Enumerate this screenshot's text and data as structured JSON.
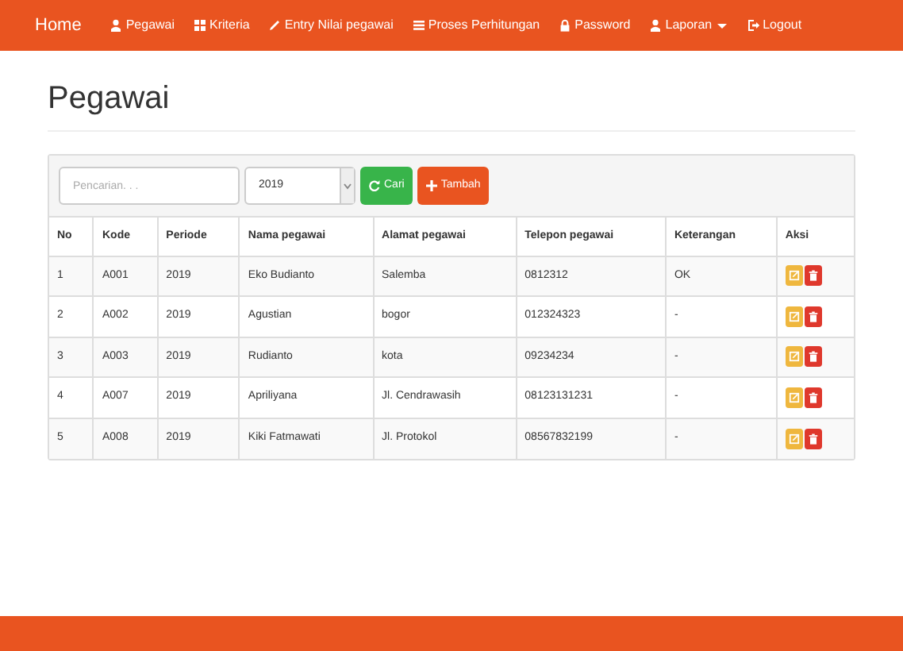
{
  "navbar": {
    "brand": "Home",
    "items": [
      {
        "label": "Pegawai",
        "dropdown": false
      },
      {
        "label": "Kriteria",
        "dropdown": false
      },
      {
        "label": "Entry Nilai pegawai",
        "dropdown": false
      },
      {
        "label": "Proses Perhitungan",
        "dropdown": false
      },
      {
        "label": "Password",
        "dropdown": false
      },
      {
        "label": "Laporan",
        "dropdown": true
      },
      {
        "label": "Logout",
        "dropdown": false
      }
    ]
  },
  "page_title": "Pegawai",
  "toolbar": {
    "search": {
      "placeholder": "Pencarian. . ."
    },
    "period": "2019",
    "buttons": [
      "Cari",
      "Tambah"
    ]
  },
  "table": {
    "columns": [
      "No",
      "Kode",
      "Periode",
      "Nama pegawai",
      "Alamat pegawai",
      "Telepon pegawai",
      "Keterangan",
      "Aksi"
    ],
    "rows": [
      [
        "1",
        "A001",
        "2019",
        "Eko Budianto",
        "Salemba",
        "0812312",
        "OK"
      ],
      [
        "2",
        "A002",
        "2019",
        "Agustian",
        "bogor",
        "012324323",
        "-"
      ],
      [
        "3",
        "A003",
        "2019",
        "Rudianto",
        "kota",
        "09234234",
        "-"
      ],
      [
        "4",
        "A007",
        "2019",
        "Apriliyana",
        "Jl. Cendrawasih",
        "08123131231",
        "-"
      ],
      [
        "5",
        "A008",
        "2019",
        "Kiki Fatmawati",
        "Jl. Protokol",
        "08567832199",
        "-"
      ]
    ]
  }
}
